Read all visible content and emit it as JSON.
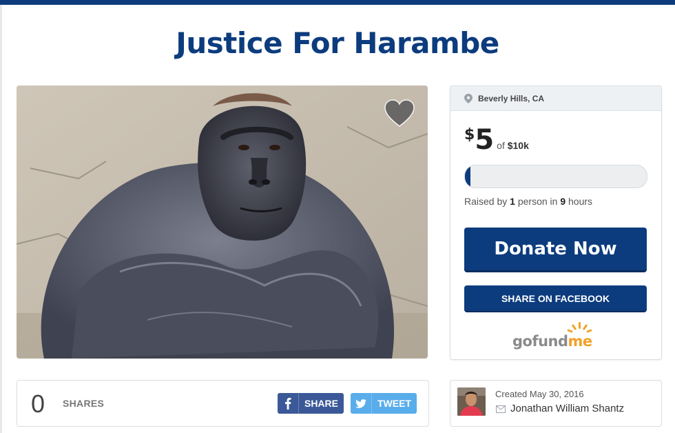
{
  "campaign": {
    "title": "Justice For Harambe"
  },
  "photo": {
    "subject": "gorilla",
    "favorite_icon": "heart-icon"
  },
  "donation_card": {
    "location": "Beverly Hills, CA",
    "currency": "$",
    "raised_amount": "5",
    "goal_prefix": "of",
    "goal": "$10k",
    "progress_percent": 0.05,
    "raised_prefix": "Raised by",
    "donor_count": "1",
    "donor_word": "person in",
    "hours": "9",
    "hours_word": "hours",
    "donate_label": "Donate Now",
    "share_facebook_label": "SHARE ON FACEBOOK",
    "logo_text_main": "gofund",
    "logo_text_accent": "me"
  },
  "shares": {
    "count": "0",
    "label": "SHARES",
    "facebook_label": "SHARE",
    "twitter_label": "TWEET"
  },
  "creator": {
    "created_text": "Created May 30, 2016",
    "name": "Jonathan William Shantz"
  },
  "colors": {
    "brand_blue": "#0c3c7e",
    "facebook": "#3b5998",
    "twitter": "#59adeb",
    "logo_orange": "#f2a127"
  }
}
